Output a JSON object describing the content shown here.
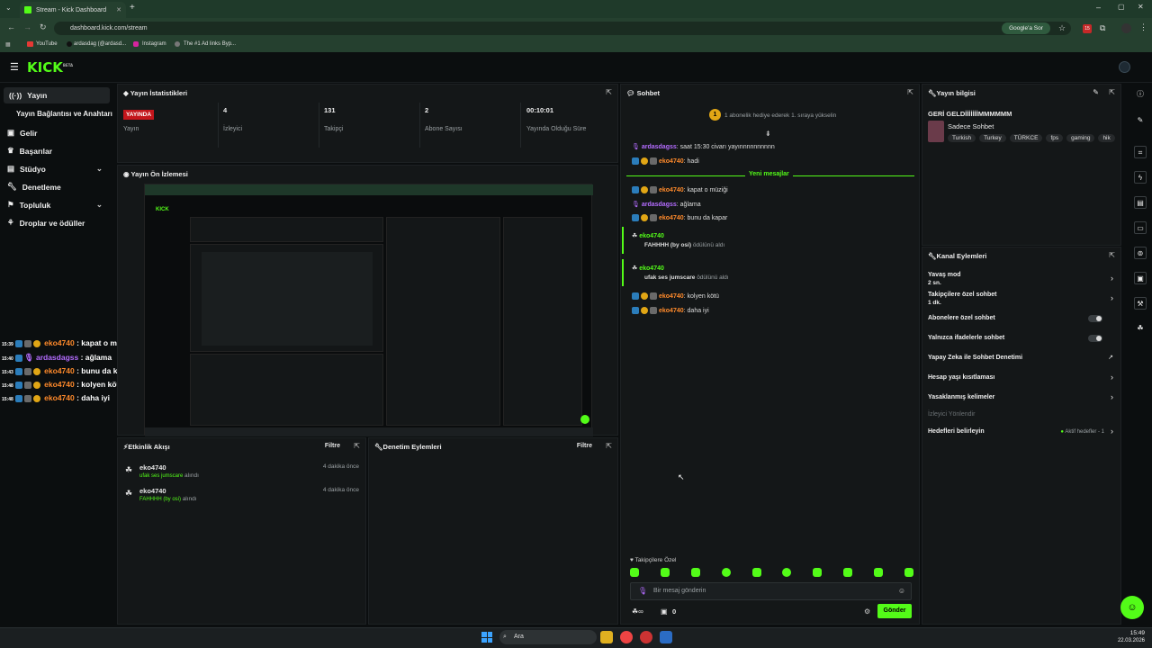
{
  "browser": {
    "tab_title": "Stream - Kick Dashboard",
    "url": "dashboard.kick.com/stream",
    "google_btn": "Google'a Sor",
    "bookmarks": [
      "YouTube",
      "ardasdag (@ardasd...",
      "Instagram",
      "The #1 Ad links Byp..."
    ],
    "ext_badge": "15"
  },
  "app": {
    "logo": "KICK",
    "logo_sup": "BETA",
    "accent": "#53fc18"
  },
  "sidebar": {
    "items": [
      {
        "label": "Yayın",
        "icon": "broadcast-icon"
      },
      {
        "label": "Yayın Bağlantısı ve Anahtarı",
        "icon": ""
      },
      {
        "label": "Gelir",
        "icon": "wallet-icon"
      },
      {
        "label": "Başarılar",
        "icon": "trophy-icon"
      },
      {
        "label": "Stüdyo",
        "icon": "studio-icon"
      },
      {
        "label": "Denetleme",
        "icon": "wrench-icon"
      },
      {
        "label": "Topluluk",
        "icon": "community-icon"
      },
      {
        "label": "Droplar ve ödüller",
        "icon": "gift-icon"
      }
    ]
  },
  "stats": {
    "title": "Yayın İstatistikleri",
    "live_badge": "YAYINDA",
    "items": [
      {
        "value": "",
        "label": "Yayın"
      },
      {
        "value": "4",
        "label": "İzleyici"
      },
      {
        "value": "131",
        "label": "Takipçi"
      },
      {
        "value": "2",
        "label": "Abone Sayısı"
      },
      {
        "value": "00:10:01",
        "label": "Yayında Olduğu Süre"
      }
    ]
  },
  "preview": {
    "title": "Yayın Ön İzlemesi"
  },
  "activity": {
    "title": "Etkinlik Akışı",
    "filter": "Filtre",
    "items": [
      {
        "user": "eko4740",
        "reward": "ufak ses jumscare",
        "suffix": "alındı",
        "time": "4 dakika önce"
      },
      {
        "user": "eko4740",
        "reward": "FAHHHH (by osi)",
        "suffix": "alındı",
        "time": "4 dakika önce"
      }
    ]
  },
  "moderation": {
    "title": "Denetim Eylemleri",
    "filter": "Filtre"
  },
  "chat": {
    "title": "Sohbet",
    "pinned": "1 abonelik hediye ederek 1. sıraya yükselin",
    "new_messages": "Yeni mesajlar",
    "messages": [
      {
        "user": "ardasdagss",
        "text": "saat 15:30 civarı yayınnnnnnnnnn",
        "color": "#b46cff"
      },
      {
        "user": "eko4740",
        "text": "hadi",
        "color": "#ff8a2b"
      },
      {
        "user": "eko4740",
        "text": "kapat o müziği",
        "color": "#ff8a2b"
      },
      {
        "user": "ardasdagss",
        "text": "ağlama",
        "color": "#b46cff"
      },
      {
        "user": "eko4740",
        "text": "bunu da kapar",
        "color": "#ff8a2b"
      },
      {
        "user": "eko4740",
        "text": "kolyen kötü",
        "color": "#ff8a2b"
      },
      {
        "user": "eko4740",
        "text": "daha iyi",
        "color": "#ff8a2b"
      }
    ],
    "rewards": [
      {
        "user": "eko4740",
        "reward": "FAHHHH (by osi)",
        "suffix": "ödülünü aldı"
      },
      {
        "user": "eko4740",
        "reward": "ufak ses jumscare",
        "suffix": "ödülünü aldı"
      }
    ],
    "followers_only": "Takipçilere Özel",
    "input_placeholder": "Bir mesaj gönderin",
    "points": "0",
    "send": "Gönder"
  },
  "stream_info": {
    "title": "Yayın bilgisi",
    "stream_title": "GERİ GELDİİİİİİİMMMMMM",
    "category": "Sadece Sohbet",
    "tags": [
      "Turkish",
      "Turkey",
      "TÜRKCE",
      "fps",
      "gaming",
      "hik"
    ]
  },
  "channel_actions": {
    "title": "Kanal Eylemleri",
    "slow_mode": {
      "label": "Yavaş mod",
      "value": "2 sn."
    },
    "followers_chat": {
      "label": "Takipçilere özel sohbet",
      "value": "1 dk."
    },
    "subs_chat": "Abonelere özel sohbet",
    "emote_only": "Yalnızca ifadelerle sohbet",
    "ai_moderation": "Yapay Zeka ile Sohbet Denetimi",
    "age_restriction": "Hesap yaşı kısıtlaması",
    "banned_words": "Yasaklanmış kelimeler",
    "viewer_redirect": "İzleyici Yönlendir",
    "set_goals": "Hedefleri belirleyin",
    "active_goals": "Aktif hedefler - 1"
  },
  "overlay_chat": [
    {
      "time": "15:39",
      "user": "eko4740",
      "text": "kapat o müziği",
      "color": "#ff8a2b"
    },
    {
      "time": "15:40",
      "user": "ardasdagss",
      "text": "ağlama",
      "color": "#b46cff"
    },
    {
      "time": "15:43",
      "user": "eko4740",
      "text": "bunu da kapar",
      "color": "#ff8a2b"
    },
    {
      "time": "15:48",
      "user": "eko4740",
      "text": "kolyen kötü",
      "color": "#ff8a2b"
    },
    {
      "time": "15:48",
      "user": "eko4740",
      "text": "daha iyi",
      "color": "#ff8a2b"
    }
  ],
  "taskbar": {
    "search": "Ara",
    "time": "15:49",
    "date": "22.03.2026"
  }
}
